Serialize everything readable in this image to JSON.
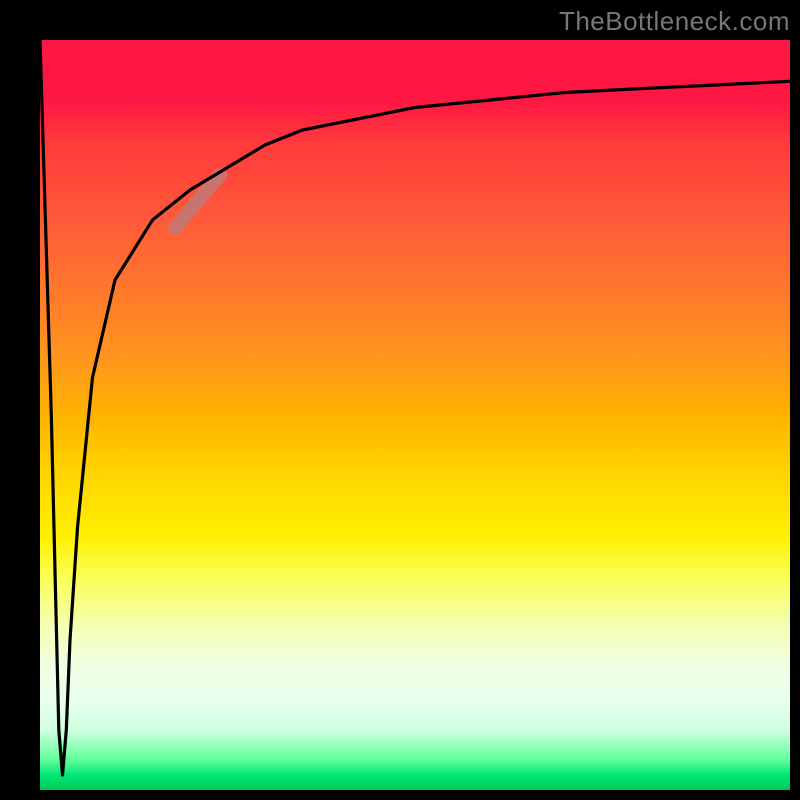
{
  "watermark": "TheBottleneck.com",
  "chart_data": {
    "type": "line",
    "title": "",
    "xlabel": "",
    "ylabel": "",
    "xlim": [
      0,
      100
    ],
    "ylim": [
      0,
      100
    ],
    "grid": false,
    "legend": false,
    "background": "rainbow-vertical-gradient (red top → green bottom)",
    "series": [
      {
        "name": "main-curve",
        "stroke": "#000000",
        "x": [
          0,
          1.5,
          2.5,
          3.0,
          3.5,
          4.0,
          5.0,
          7.0,
          10,
          15,
          20,
          25,
          30,
          35,
          40,
          50,
          60,
          70,
          80,
          90,
          100
        ],
        "y": [
          100,
          50,
          8,
          2,
          8,
          20,
          35,
          55,
          68,
          76,
          80,
          83,
          86,
          88,
          89,
          91,
          92,
          93,
          93.5,
          94,
          94.5
        ],
        "note": "values estimated from pixels; sharp V-dip near x≈3 then asymptotic rise"
      },
      {
        "name": "highlight-segment",
        "stroke": "#bf7a7a",
        "stroke_width_approx": 14,
        "x": [
          18,
          24
        ],
        "y": [
          75,
          82
        ],
        "note": "thick pinkish-brown segment overlaid on main curve near knee"
      }
    ]
  }
}
